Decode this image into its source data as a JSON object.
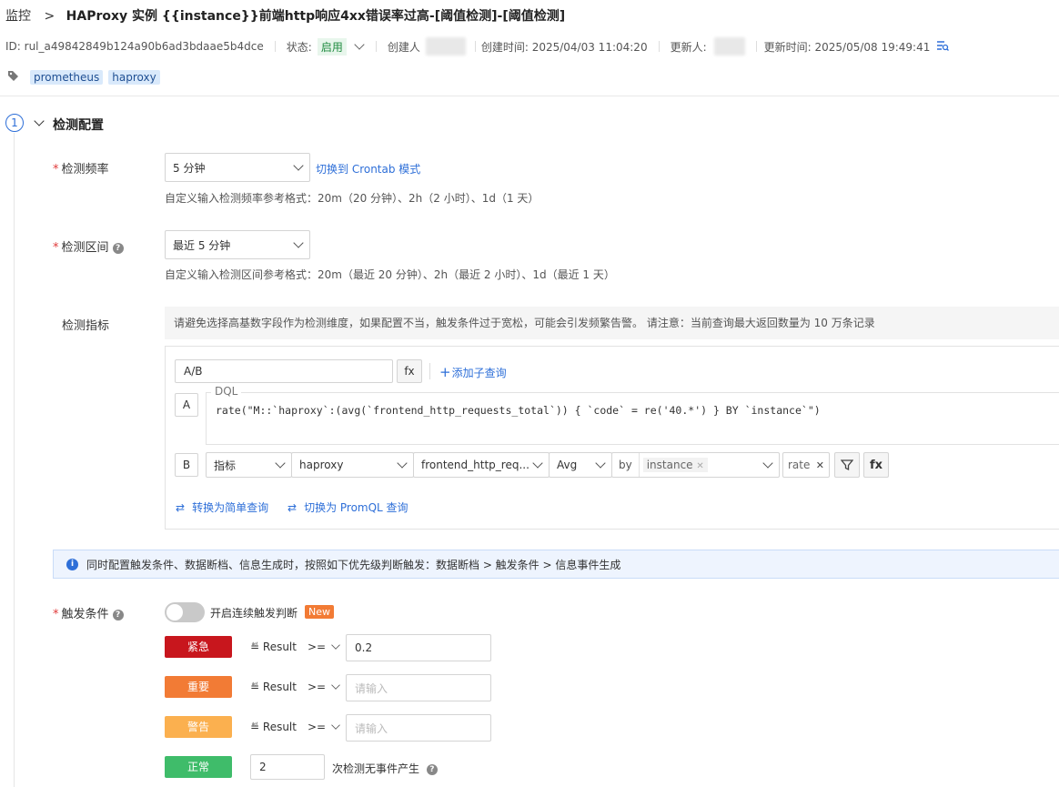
{
  "breadcrumb": {
    "root": "监控",
    "title": "HAProxy 实例 {{instance}}前端http响应4xx错误率过高-[阈值检测]-[阈值检测]"
  },
  "meta": {
    "id": "ID: rul_a49842849b124a90b6ad3bdaae5b4dce",
    "status_label": "状态:",
    "status_value": "启用",
    "creator_label": "创建人",
    "created_time": "创建时间: 2025/04/03 11:04:20",
    "updater_label": "更新人:",
    "updated_time": "更新时间: 2025/05/08 19:49:41"
  },
  "tags": [
    "prometheus",
    "haproxy"
  ],
  "section": {
    "step": "1",
    "title": "检测配置"
  },
  "frequency": {
    "label": "检测频率",
    "value": "5 分钟",
    "switch_link": "切换到 Crontab 模式",
    "hint": "自定义输入检测频率参考格式：20m（20 分钟）、2h（2 小时）、1d（1 天）"
  },
  "interval": {
    "label": "检测区间",
    "value": "最近 5 分钟",
    "hint": "自定义输入检测区间参考格式：20m（最近 20 分钟）、2h（最近 2 小时）、1d（最近 1 天）"
  },
  "metrics": {
    "label": "检测指标",
    "notice": "请避免选择高基数字段作为检测维度，如果配置不当，触发条件过于宽松，可能会引发频繁告警。 请注意：当前查询最大返回数量为 10 万条记录",
    "expression": "A/B",
    "fx": "fx",
    "add_subquery": "添加子查询",
    "query_a": {
      "letter": "A",
      "mode": "DQL",
      "text": "rate(\"M::`haproxy`:(avg(`frontend_http_requests_total`)) { `code` = re('40.*') } BY `instance`\")"
    },
    "query_b": {
      "letter": "B",
      "type": "指标",
      "measurement": "haproxy",
      "field": "frontend_http_req...",
      "agg": "Avg",
      "by": "by",
      "group_tag": "instance",
      "func": "rate",
      "fx": "fx"
    },
    "convert_simple": "转换为简单查询",
    "convert_promql": "切换为 PromQL 查询"
  },
  "info_banner": "同时配置触发条件、数据断档、信息生成时，按照如下优先级判断触发：数据断档 > 触发条件 > 信息事件生成",
  "trigger": {
    "label": "触发条件",
    "toggle_label": "开启连续触发判断",
    "new_badge": "New",
    "rows": [
      {
        "level": "紧急",
        "color": "#c8161d",
        "result": "Result",
        "op": ">=",
        "value": "0.2",
        "placeholder": ""
      },
      {
        "level": "重要",
        "color": "#f27b35",
        "result": "Result",
        "op": ">=",
        "value": "",
        "placeholder": "请输入"
      },
      {
        "level": "警告",
        "color": "#fbb04f",
        "result": "Result",
        "op": ">=",
        "value": "",
        "placeholder": "请输入"
      }
    ],
    "normal": {
      "level": "正常",
      "color": "#3fbc6a",
      "value": "2",
      "suffix": "次检测无事件产生"
    }
  }
}
